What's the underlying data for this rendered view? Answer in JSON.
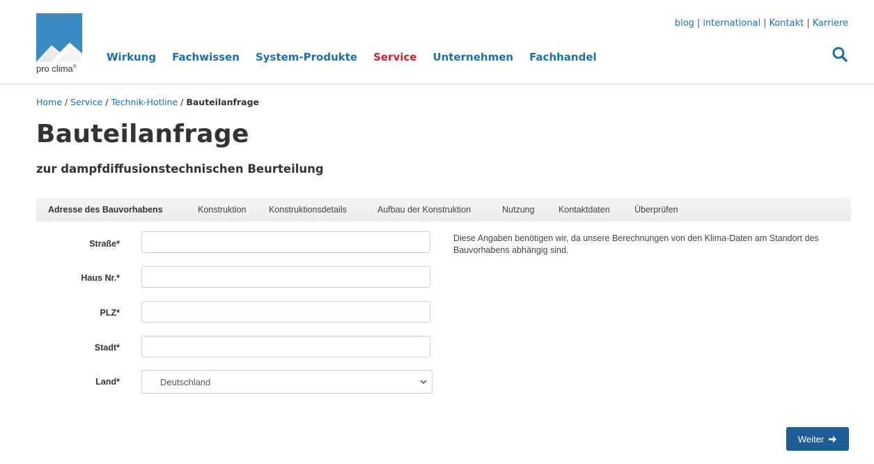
{
  "brand": {
    "logo_text": "pro clima",
    "logo_mark": "®",
    "brand_color": "#3a8ac4"
  },
  "main_nav": [
    {
      "label": "Wirkung",
      "active": false
    },
    {
      "label": "Fachwissen",
      "active": false
    },
    {
      "label": "System-Produkte",
      "active": false
    },
    {
      "label": "Service",
      "active": true
    },
    {
      "label": "Unternehmen",
      "active": false
    },
    {
      "label": "Fachhandel",
      "active": false
    }
  ],
  "top_links": [
    "blog",
    "international",
    "Kontakt",
    "Karriere"
  ],
  "top_separator": "|",
  "search_icon": "search-icon",
  "breadcrumb": {
    "items": [
      "Home",
      "Service",
      "Technik-Hotline"
    ],
    "separator": "/",
    "current": "Bauteilanfrage"
  },
  "page": {
    "title": "Bauteilanfrage",
    "subtitle": "zur dampfdiffusionstechnischen Beurteilung"
  },
  "steps": [
    {
      "label": "Adresse des Bauvorhabens",
      "active": true
    },
    {
      "label": "Konstruktion",
      "active": false
    },
    {
      "label": "Konstruktionsdetails",
      "active": false
    },
    {
      "label": "Aufbau der Konstruktion",
      "active": false
    },
    {
      "label": "Nutzung",
      "active": false
    },
    {
      "label": "Kontaktdaten",
      "active": false
    },
    {
      "label": "Überprüfen",
      "active": false
    }
  ],
  "form": {
    "street_label": "Straße*",
    "street_value": "",
    "house_label": "Haus Nr.*",
    "house_value": "",
    "zip_label": "PLZ*",
    "zip_value": "",
    "city_label": "Stadt*",
    "city_value": "",
    "country_label": "Land*",
    "country_value": "Deutschland"
  },
  "info_text": "Diese Angaben benötigen wir, da unsere Berechnungen von den Klima-Daten am Standort des Bauvorhabens abhängig sind.",
  "next_button": {
    "label": "Weiter",
    "color": "#1f5d96"
  },
  "colors": {
    "link": "#1f6fae",
    "active_nav": "#d0202e"
  }
}
